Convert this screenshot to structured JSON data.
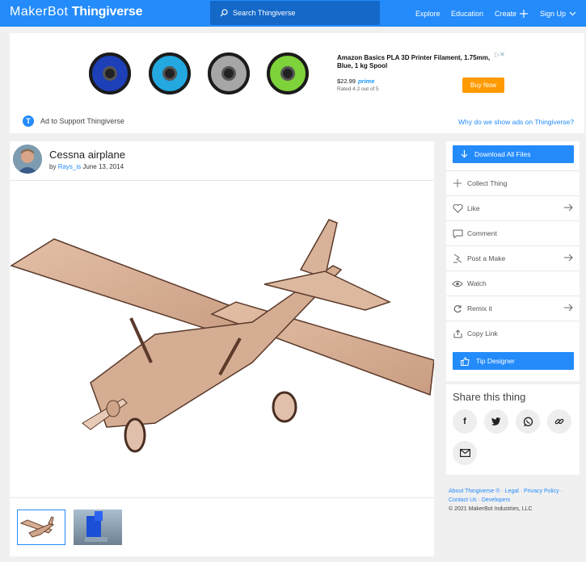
{
  "header": {
    "logo_brand": "MakerBot",
    "logo_name": "Thingiverse",
    "search_placeholder": "Search Thingiverse",
    "nav": {
      "explore": "Explore",
      "education": "Education",
      "create": "Create",
      "signup": "Sign Up"
    }
  },
  "ad": {
    "title": "Amazon Basics PLA 3D Printer Filament, 1.75mm, Blue, 1 kg Spool",
    "price": "$22.99",
    "prime": "prime",
    "rated": "Rated 4.2 out of 5",
    "buy": "Buy Now",
    "support": "Ad to Support Thingiverse",
    "why": "Why do we show ads on Thingiverse?",
    "spool_colors": [
      "#1d3fb8",
      "#23a8e0",
      "#a6a6a6",
      "#7ed23a"
    ]
  },
  "thing": {
    "title": "Cessna airplane",
    "by": "by",
    "author": "Rays_is",
    "date": "June 13, 2014"
  },
  "sidebar": {
    "download": "Download All Files",
    "actions": [
      "Collect Thing",
      "Like",
      "Comment",
      "Post a Make",
      "Watch",
      "Remix it",
      "Copy Link"
    ],
    "tip": "Tip Designer",
    "share_title": "Share this thing"
  },
  "footer": {
    "about": "About Thingiverse ®",
    "legal": "Legal",
    "privacy": "Privacy Policy",
    "contact": "Contact Us",
    "developers": "Developers",
    "copyright": "© 2021 MakerBot Industries, LLC"
  },
  "colors": {
    "accent": "#248bfb",
    "buy": "#ff9a00"
  }
}
